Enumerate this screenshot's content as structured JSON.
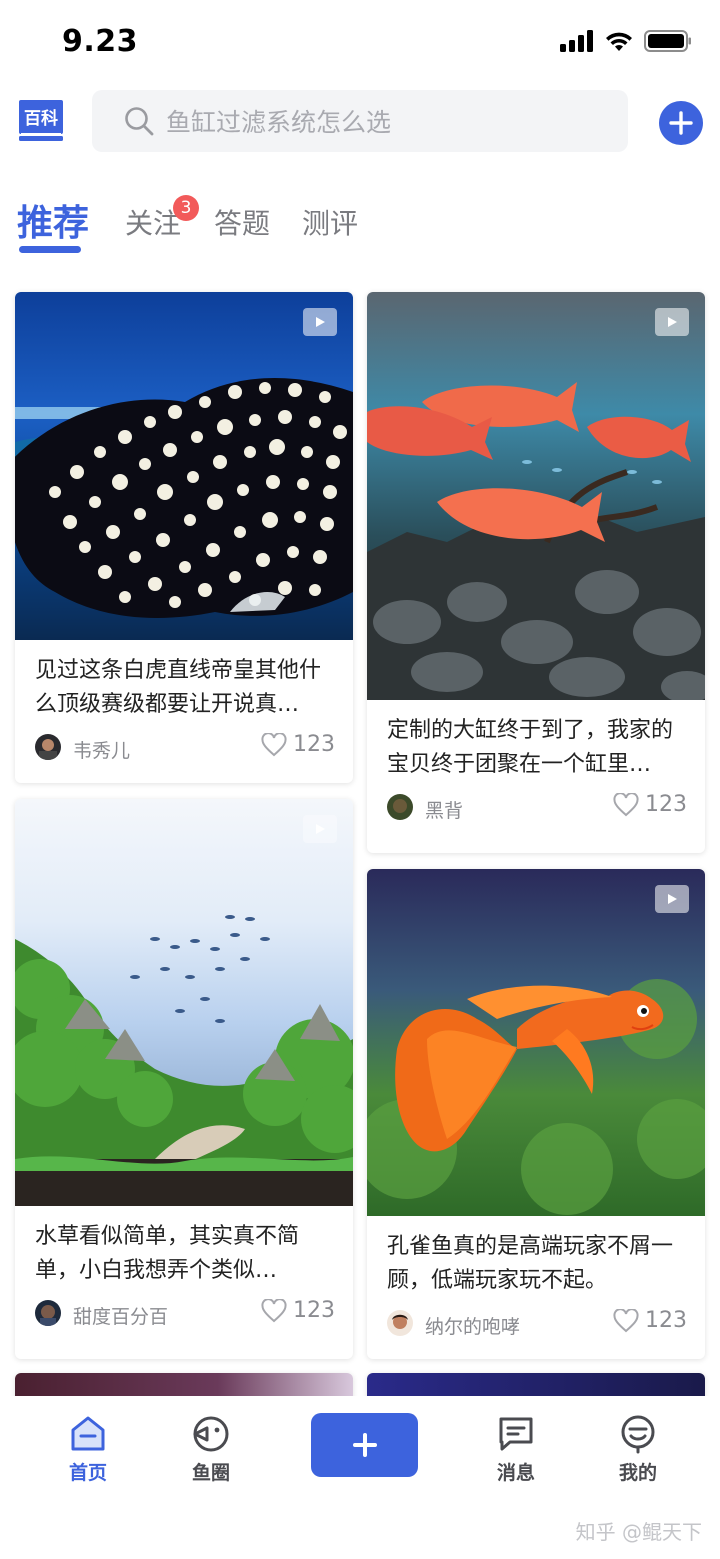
{
  "status_bar": {
    "time": "9.23"
  },
  "header": {
    "logo_text": "百科",
    "search_placeholder": "鱼缸过滤系统怎么选"
  },
  "tabs": [
    {
      "label": "推荐",
      "active": true
    },
    {
      "label": "关注",
      "badge": "3"
    },
    {
      "label": "答题"
    },
    {
      "label": "测评"
    }
  ],
  "feed": [
    {
      "title": "见过这条白虎直线帝皇其他什么顶级赛级都要让开说真…",
      "author": "韦秀儿",
      "likes": "123",
      "image": "stingray",
      "video": true
    },
    {
      "title": "定制的大缸终于到了，我家的宝贝终于团聚在一个缸里…",
      "author": "黑背",
      "likes": "123",
      "image": "arowana-tank",
      "video": true
    },
    {
      "title": "水草看似简单，其实真不简单，小白我想弄个类似…",
      "author": "甜度百分百",
      "likes": "123",
      "image": "aquascape",
      "video": true
    },
    {
      "title": "孔雀鱼真的是高端玩家不屑一顾，低端玩家玩不起。",
      "author": "纳尔的咆哮",
      "likes": "123",
      "image": "guppy",
      "video": true
    }
  ],
  "bottom_nav": {
    "items": [
      {
        "label": "首页",
        "icon": "home-icon",
        "active": true
      },
      {
        "label": "鱼圈",
        "icon": "fish-circle-icon"
      },
      {
        "label": "消息",
        "icon": "message-icon"
      },
      {
        "label": "我的",
        "icon": "profile-icon"
      }
    ],
    "post_icon": "plus-icon"
  },
  "watermark": "知乎 @鲲天下",
  "colors": {
    "accent": "#3d63dd",
    "badge": "#f25a5a",
    "search_bg": "#f3f4f6"
  }
}
